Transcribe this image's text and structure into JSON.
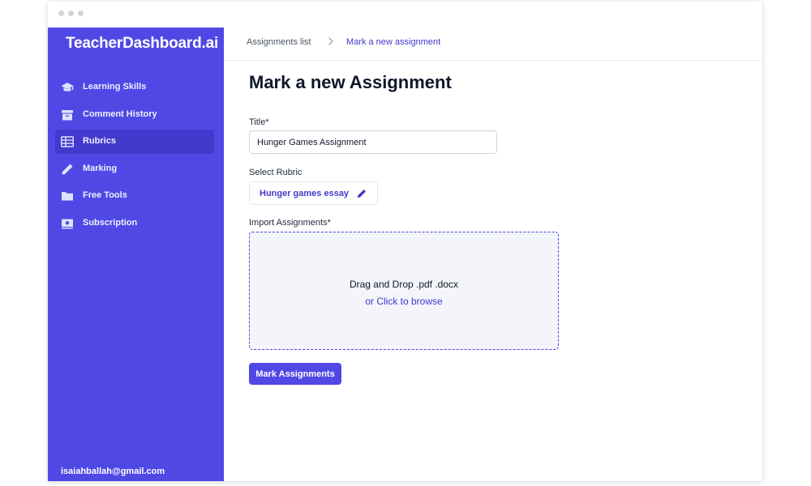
{
  "window": {
    "traffic_light_color": "#d4d4d8"
  },
  "sidebar": {
    "brand": "TeacherDashboard.ai",
    "background": "#5048e5",
    "active_background": "#4339cc",
    "items": [
      {
        "label": "Learning Skills",
        "icon": "graduation-cap-icon"
      },
      {
        "label": "Comment History",
        "icon": "archive-box-icon"
      },
      {
        "label": "Rubrics",
        "icon": "table-icon",
        "active": true
      },
      {
        "label": "Marking",
        "icon": "pencil-icon"
      },
      {
        "label": "Free Tools",
        "icon": "folder-icon"
      },
      {
        "label": "Subscription",
        "icon": "billing-icon"
      }
    ],
    "user_email": "isaiahballah@gmail.com"
  },
  "breadcrumb": {
    "items": [
      "Assignments list",
      "Mark a new assignment"
    ],
    "separator_icon": "chevron-right-icon"
  },
  "page": {
    "title": "Mark a new Assignment"
  },
  "form": {
    "title_label": "Title*",
    "title_value": "Hunger Games Assignment",
    "rubric_label": "Select Rubric",
    "rubric_value": "Hunger games essay",
    "rubric_icon": "pencil-icon",
    "import_label": "Import Assignments*",
    "dropzone_text": "Drag and Drop .pdf .docx",
    "dropzone_link": "or Click to browse",
    "submit_label": "Mark Assignments"
  },
  "colors": {
    "accent": "#5048e5",
    "link": "#4338ca",
    "dropzone_bg": "#f3f5fa"
  }
}
